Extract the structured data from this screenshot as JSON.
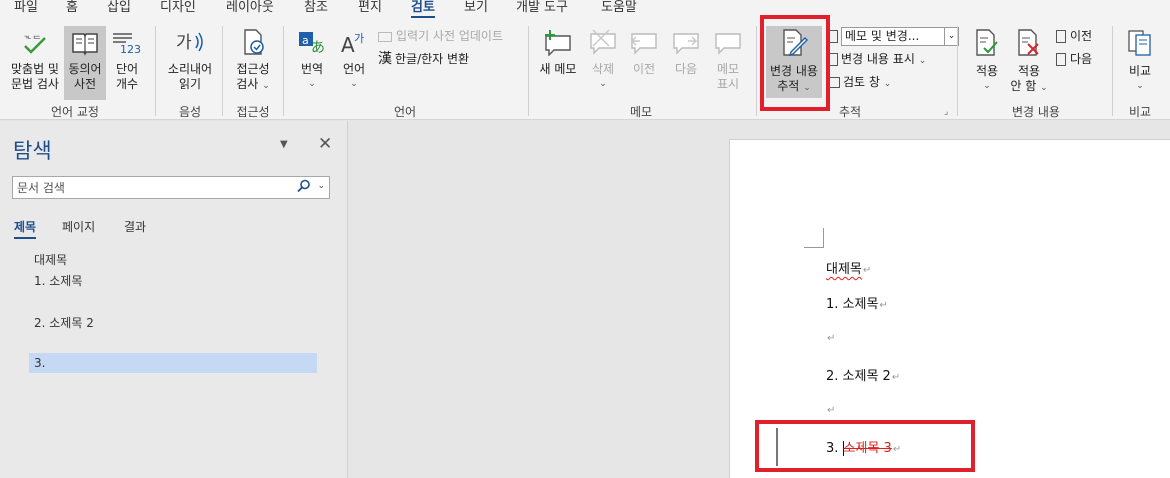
{
  "menu": {
    "tabs": [
      "파일",
      "홈",
      "삽입",
      "디자인",
      "레이아웃",
      "참조",
      "편지",
      "검토",
      "보기",
      "개발 도구",
      "도움말"
    ],
    "active": "검토"
  },
  "ribbon": {
    "proofing": {
      "spelling": [
        "맞춤법 및",
        "문법 검사"
      ],
      "thesaurus": [
        "동의어",
        "사전"
      ],
      "wordcount": [
        "단어",
        "개수"
      ],
      "wordcount_badge": "123",
      "label": "언어 교정"
    },
    "speech": {
      "read_aloud": [
        "소리내어",
        "읽기"
      ],
      "label": "음성"
    },
    "accessibility": {
      "check": [
        "접근성",
        "검사"
      ],
      "label": "접근성"
    },
    "language": {
      "translate": "번역",
      "language_btn": "언어",
      "ime_update": "입력기 사전 업데이트",
      "hanja": "한글/한자 변환",
      "hanja_glyph": "漢",
      "label": "언어"
    },
    "comments": {
      "new": "새 메모",
      "delete": "삭제",
      "prev": "이전",
      "next": "다음",
      "show": [
        "메모",
        "표시"
      ],
      "label": "메모"
    },
    "tracking": {
      "track": [
        "변경 내용",
        "추적"
      ],
      "markup_select": "메모 및 변경...",
      "show_markup": "변경 내용 표시",
      "review_pane": "검토 창",
      "label": "추적"
    },
    "changes": {
      "accept": "적용",
      "reject": [
        "적용",
        "안 함"
      ],
      "prev": "이전",
      "next": "다음",
      "label": "변경 내용"
    },
    "compare": {
      "compare": "비교",
      "label": "비교"
    }
  },
  "nav": {
    "title": "탐색",
    "search_placeholder": "문서 검색",
    "tabs": [
      "제목",
      "페이지",
      "결과"
    ],
    "headings": [
      "대제목",
      "1. 소제목",
      "2. 소제목 2",
      "3."
    ]
  },
  "document": {
    "title": "대제목",
    "item1": "1.  소제목",
    "item2": "2.  소제목  2",
    "item3_num": "3.  ",
    "item3_deleted": "소제목  3"
  },
  "colors": {
    "accent": "#1e4e8c",
    "highlight": "#e0202a",
    "selection": "#c5d9f4"
  }
}
